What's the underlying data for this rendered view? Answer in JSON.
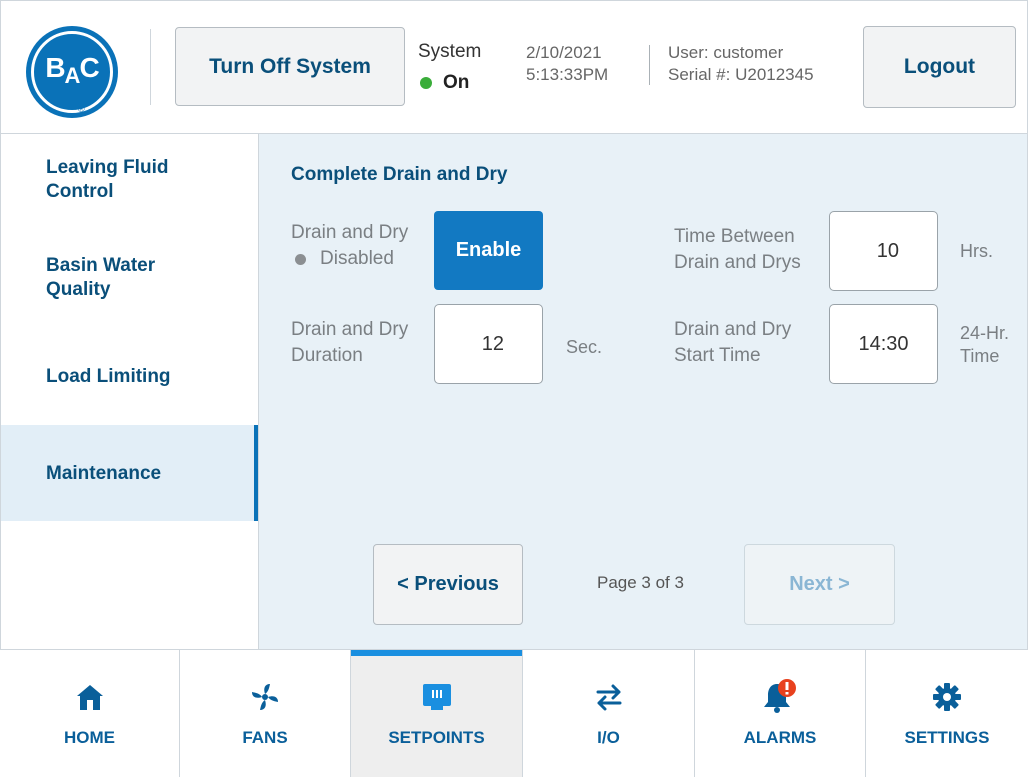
{
  "header": {
    "logo_text": "BAC",
    "turn_off_label": "Turn Off System",
    "system_label": "System",
    "system_status": "On",
    "date": "2/10/2021",
    "time": "5:13:33PM",
    "user": "User: customer",
    "serial": "Serial #: U2012345",
    "logout_label": "Logout"
  },
  "sidebar": {
    "items": [
      {
        "label_line1": "Leaving Fluid",
        "label_line2": "Control"
      },
      {
        "label_line1": "Basin Water",
        "label_line2": "Quality"
      },
      {
        "label_line1": "Load Limiting",
        "label_line2": ""
      },
      {
        "label_line1": "Maintenance",
        "label_line2": "",
        "active": true
      }
    ]
  },
  "main": {
    "section_title": "Complete Drain and Dry",
    "drain_dry_label": "Drain and Dry",
    "drain_dry_status": "Disabled",
    "enable_label": "Enable",
    "duration_label_line1": "Drain and Dry",
    "duration_label_line2": "Duration",
    "duration_value": "12",
    "duration_unit": "Sec.",
    "between_label_line1": "Time Between",
    "between_label_line2": "Drain and Drys",
    "between_value": "10",
    "between_unit": "Hrs.",
    "start_label_line1": "Drain and Dry",
    "start_label_line2": "Start Time",
    "start_value": "14:30",
    "start_unit_line1": "24-Hr.",
    "start_unit_line2": "Time",
    "previous_label": "< Previous",
    "next_label": "Next >",
    "page_indicator": "Page 3 of 3"
  },
  "bottom_nav": {
    "tabs": [
      {
        "label": "HOME",
        "icon": "home-icon"
      },
      {
        "label": "FANS",
        "icon": "fan-icon"
      },
      {
        "label": "SETPOINTS",
        "icon": "setpoints-icon",
        "active": true
      },
      {
        "label": "I/O",
        "icon": "io-arrows-icon"
      },
      {
        "label": "ALARMS",
        "icon": "alarm-bell-icon"
      },
      {
        "label": "SETTINGS",
        "icon": "gear-icon"
      }
    ]
  },
  "colors": {
    "brand_blue": "#0a72b8",
    "text_blue": "#0a4f7a",
    "status_green": "#3aad3a",
    "alarm_red": "#e8411e",
    "active_tab_bar": "#1a8fe0"
  }
}
